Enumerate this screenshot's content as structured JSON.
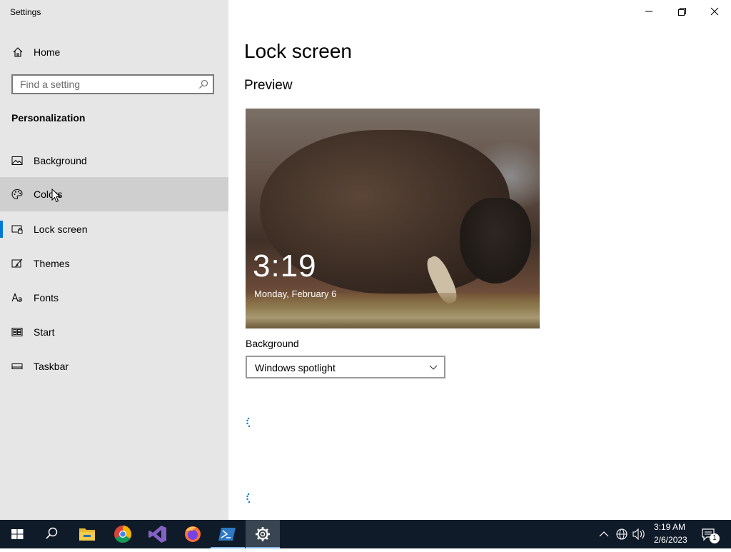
{
  "window": {
    "title": "Settings"
  },
  "sidebar": {
    "home_label": "Home",
    "search_placeholder": "Find a setting",
    "section_title": "Personalization",
    "items": [
      {
        "label": "Background",
        "icon": "picture-icon"
      },
      {
        "label": "Colors",
        "icon": "palette-icon"
      },
      {
        "label": "Lock screen",
        "icon": "lock-screen-icon"
      },
      {
        "label": "Themes",
        "icon": "brush-icon"
      },
      {
        "label": "Fonts",
        "icon": "font-icon"
      },
      {
        "label": "Start",
        "icon": "start-icon"
      },
      {
        "label": "Taskbar",
        "icon": "taskbar-icon"
      }
    ],
    "hovered_item": "Colors",
    "selected_item": "Lock screen"
  },
  "main": {
    "page_title": "Lock screen",
    "preview_heading": "Preview",
    "preview": {
      "time": "3:19",
      "date": "Monday, February 6"
    },
    "background_label": "Background",
    "background_value": "Windows spotlight"
  },
  "taskbar": {
    "apps": [
      "windows-start",
      "search",
      "file-explorer",
      "chrome",
      "visual-studio",
      "firefox",
      "powershell",
      "settings"
    ],
    "active_app": "settings",
    "clock_time": "3:19 AM",
    "clock_date": "2/6/2023",
    "notification_count": "1"
  },
  "colors": {
    "accent": "#0078d7",
    "sidebar_bg": "#e6e6e6",
    "taskbar_bg": "#101b29"
  }
}
